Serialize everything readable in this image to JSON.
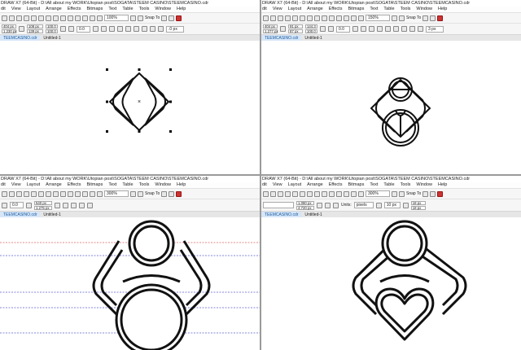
{
  "panes": [
    {
      "title": "DRAW X7 (64-Bit) - D:\\All about my WORK\\Utopian post\\SOGATA\\STEEM CASINO\\STEEMCASINO.cdr",
      "menu": [
        "dit",
        "View",
        "Layout",
        "Arrange",
        "Effects",
        "Bitmaps",
        "Text",
        "Table",
        "Tools",
        "Window",
        "Help"
      ],
      "zoom": "100%",
      "snap": "Snap To",
      "pos_x": "404 px",
      "pos_y": "1.230 px",
      "size_w": "108 px",
      "size_h": "139 px",
      "scale_w": "100.0",
      "scale_h": "100.0",
      "rotation": "0.0",
      "outline": ".0 px",
      "tabs": [
        "TEEMCASINO.cdr",
        "Untitled-1"
      ]
    },
    {
      "title": "DRAW X7 (64-Bit) - D:\\All about my WORK\\Utopian post\\SOGATA\\STEEM CASINO\\STEEMCASINO.cdr",
      "menu": [
        "dit",
        "View",
        "Layout",
        "Arrange",
        "Effects",
        "Bitmaps",
        "Text",
        "Table",
        "Tools",
        "Window",
        "Help"
      ],
      "zoom": "150%",
      "snap": "Snap To",
      "pos_x": "404 px",
      "pos_y": "1.277 px",
      "size_w": "91 px",
      "size_h": "87 px",
      "scale_w": "144.3",
      "scale_h": "100.0",
      "rotation": "0.0",
      "outline": "3 px",
      "tabs": [
        "TEEMCASINO.cdr",
        "Untitled-1"
      ]
    },
    {
      "title": "DRAW X7 (64-Bit) - D:\\All about my WORK\\Utopian post\\SOGATA\\STEEM CASINO\\STEEMCASINO.cdr",
      "menu": [
        "dit",
        "View",
        "Layout",
        "Arrange",
        "Effects",
        "Bitmaps",
        "Text",
        "Table",
        "Tools",
        "Window",
        "Help"
      ],
      "zoom": "300%",
      "snap": "Snap To",
      "rotation": "0.0",
      "pos_x": "540 px",
      "pos_y": "1.275 px",
      "tabs": [
        "TEEMCASINO.cdr",
        "Untitled-1"
      ]
    },
    {
      "title": "DRAW X7 (64-Bit) - D:\\All about my WORK\\Utopian post\\SOGATA\\STEEM CASINO\\STEEMCASINO.cdr",
      "menu": [
        "dit",
        "View",
        "Layout",
        "Arrange",
        "Effects",
        "Bitmaps",
        "Text",
        "Table",
        "Tools",
        "Window",
        "Help"
      ],
      "zoom": "300%",
      "snap": "Snap To",
      "size_w": "1.080 px",
      "size_h": "4.720 px",
      "units_label": "Units:",
      "units": "pixels",
      "nudge": "10 px",
      "dup_x": "18 px",
      "dup_y": "18 px",
      "tabs": [
        "TEEMCASINO.cdr",
        "Untitled-1"
      ]
    }
  ],
  "colors": {
    "guide_red": "#e06060",
    "guide_blue": "#5a60d0",
    "stroke": "#111111"
  }
}
